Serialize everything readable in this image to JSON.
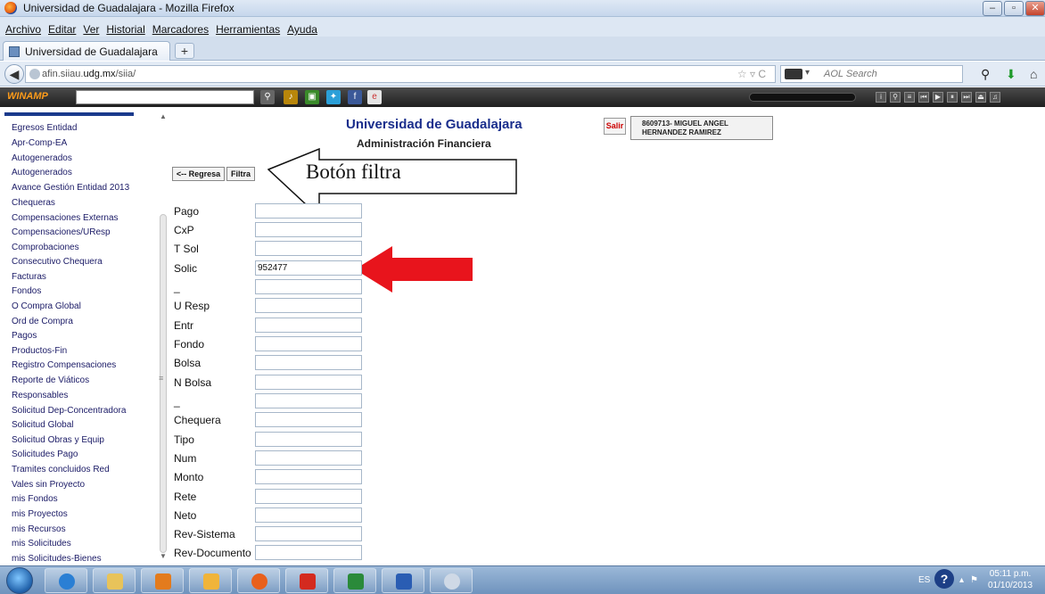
{
  "window": {
    "title": "Universidad de Guadalajara - Mozilla Firefox",
    "min_icon": "minimize-icon",
    "max_icon": "maximize-icon",
    "close_icon": "close-icon"
  },
  "menu": [
    "Archivo",
    "Editar",
    "Ver",
    "Historial",
    "Marcadores",
    "Herramientas",
    "Ayuda"
  ],
  "tab": {
    "label": "Universidad de Guadalajara",
    "new_tab_symbol": "+"
  },
  "nav": {
    "url_domain_host": "afin.siiau.",
    "url_domain_bold": "udg.mx",
    "url_path": "/siia/",
    "search_placeholder": "AOL Search",
    "back_symbol": "◀"
  },
  "winamp": {
    "logo": "WINAMP"
  },
  "sidebar": {
    "items": [
      "Egresos Entidad",
      "Apr-Comp-EA",
      "Autogenerados",
      "Autogenerados",
      "Avance Gestión Entidad 2013",
      "Chequeras",
      "Compensaciones Externas",
      "Compensaciones/UResp",
      "Comprobaciones",
      "Consecutivo Chequera",
      "Facturas",
      "Fondos",
      "O Compra Global",
      "Ord de Compra",
      "Pagos",
      "Productos-Fin",
      "Registro Compensaciones",
      "Reporte de Viáticos",
      "Responsables",
      "Solicitud Dep-Concentradora",
      "Solicitud Global",
      "Solicitud Obras y Equip",
      "Solicitudes Pago",
      "Tramites concluidos Red",
      "Vales sin Proyecto",
      "mis Fondos",
      "mis Proyectos",
      "mis Recursos",
      "mis Solicitudes",
      "mis Solicitudes-Bienes"
    ]
  },
  "header": {
    "title": "Universidad de Guadalajara",
    "subtitle": "Administración Financiera",
    "salir": "Salir",
    "user_line1": "8609713- MIGUEL ANGEL",
    "user_line2": "HERNANDEZ RAMIREZ"
  },
  "buttons": {
    "regresa": "<-- Regresa",
    "filtra": "Filtra"
  },
  "annotation": {
    "callout": "Botón filtra"
  },
  "form": {
    "fields": [
      {
        "label": "Pago",
        "value": ""
      },
      {
        "label": "CxP",
        "value": ""
      },
      {
        "label": "T Sol",
        "value": ""
      },
      {
        "label": "Solic",
        "value": "952477"
      },
      {
        "label": "_",
        "value": ""
      },
      {
        "label": "U Resp",
        "value": ""
      },
      {
        "label": "Entr",
        "value": ""
      },
      {
        "label": "Fondo",
        "value": ""
      },
      {
        "label": "Bolsa",
        "value": ""
      },
      {
        "label": "N Bolsa",
        "value": ""
      },
      {
        "label": "_",
        "value": ""
      },
      {
        "label": "Chequera",
        "value": ""
      },
      {
        "label": "Tipo",
        "value": ""
      },
      {
        "label": "Num",
        "value": ""
      },
      {
        "label": "Monto",
        "value": ""
      },
      {
        "label": "Rete",
        "value": ""
      },
      {
        "label": "Neto",
        "value": ""
      },
      {
        "label": "Rev-Sistema",
        "value": ""
      },
      {
        "label": "Rev-Documento",
        "value": ""
      }
    ]
  },
  "taskbar": {
    "lang": "ES",
    "time": "05:11 p.m.",
    "date": "01/10/2013"
  },
  "colors": {
    "arrow_red": "#e8141c",
    "title_blue": "#1a2e8c"
  }
}
